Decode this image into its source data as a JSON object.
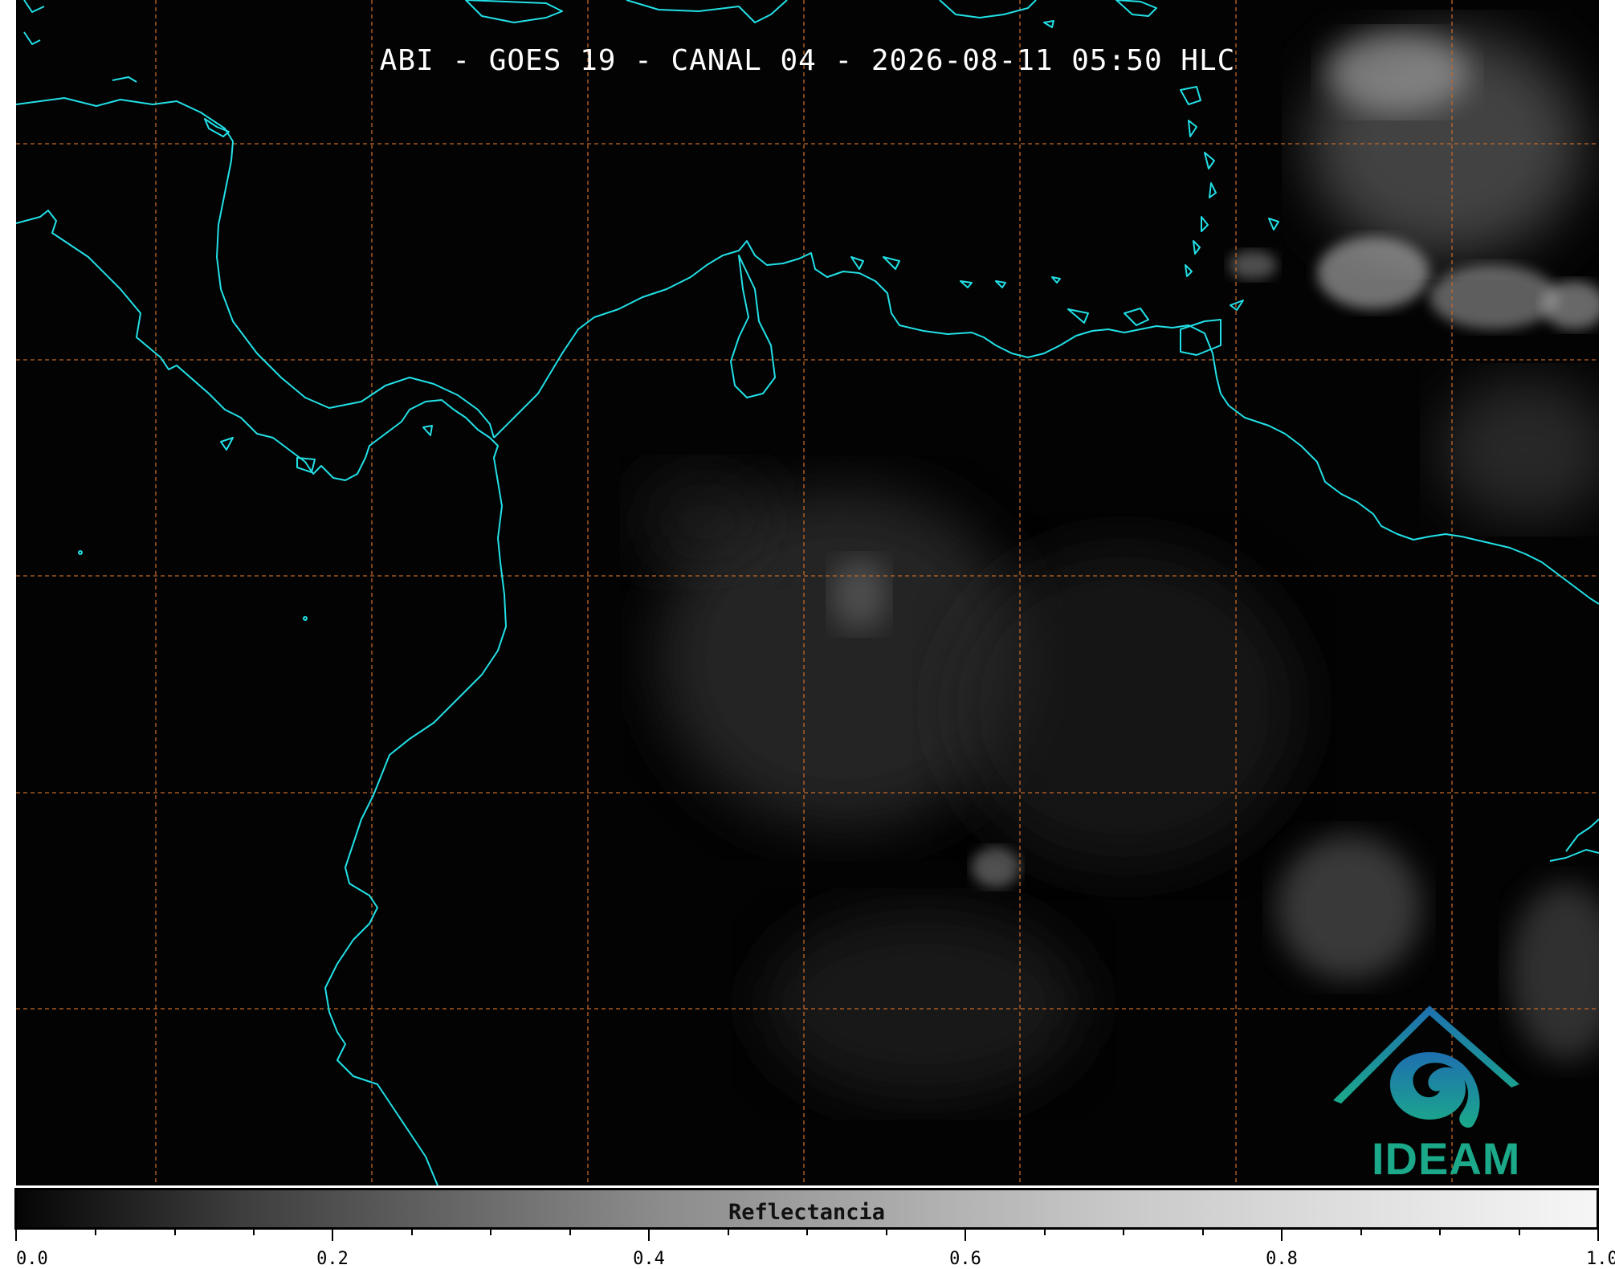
{
  "title": "ABI - GOES 19 - CANAL 04 - 2026-08-11 05:50 HLC",
  "colorbar": {
    "label": "Reflectancia",
    "range": [
      0.0,
      1.0
    ],
    "tick_labels": [
      "0.0",
      "0.2",
      "0.4",
      "0.6",
      "0.8",
      "1.0"
    ]
  },
  "logo": {
    "text": "IDEAM",
    "colors": [
      "#1e6fb0",
      "#1ba98a"
    ]
  },
  "colors": {
    "background": "#030303",
    "coastline": "#22e0e6",
    "graticule": "#c0682a"
  },
  "graticule": {
    "style": "dashed",
    "meridians": 7,
    "parallels": 5
  }
}
